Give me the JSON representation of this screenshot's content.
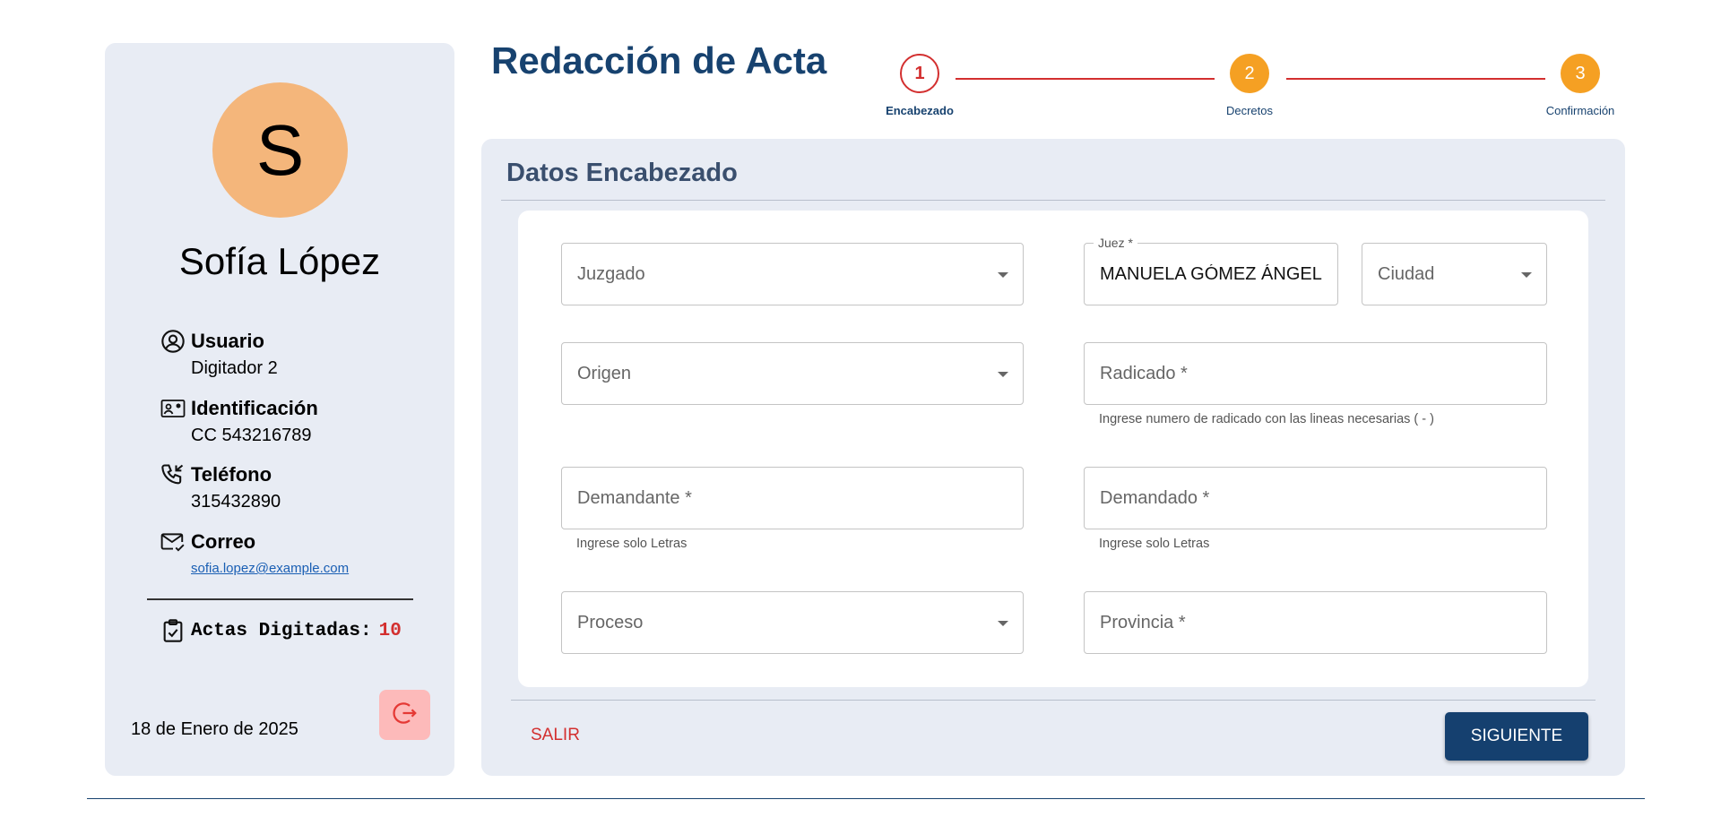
{
  "sidebar": {
    "avatar_letter": "S",
    "profile_name": "Sofía López",
    "usuario_label": "Usuario",
    "usuario_value": "Digitador 2",
    "identificacion_label": "Identificación",
    "identificacion_value": "CC 543216789",
    "telefono_label": "Teléfono",
    "telefono_value": "315432890",
    "correo_label": "Correo",
    "correo_value": "sofia.lopez@example.com",
    "actas_label": "Actas Digitadas:",
    "actas_count": "10",
    "date": "18 de Enero de 2025",
    "logout_icon": "logout-icon"
  },
  "header": {
    "title": "Redacción de Acta"
  },
  "stepper": {
    "steps": [
      {
        "number": "1",
        "label": "Encabezado",
        "state": "active"
      },
      {
        "number": "2",
        "label": "Decretos",
        "state": "pending"
      },
      {
        "number": "3",
        "label": "Confirmación",
        "state": "pending"
      }
    ]
  },
  "form": {
    "section_title": "Datos Encabezado",
    "juzgado_placeholder": "Juzgado",
    "juez_label": "Juez *",
    "juez_value": "MANUELA GÓMEZ ÁNGEL",
    "ciudad_placeholder": "Ciudad",
    "origen_placeholder": "Origen",
    "radicado_placeholder": "Radicado *",
    "radicado_helper": "Ingrese numero de radicado con las lineas necesarias ( - )",
    "demandante_placeholder": "Demandante *",
    "demandante_helper": "Ingrese solo Letras",
    "demandado_placeholder": "Demandado *",
    "demandado_helper": "Ingrese solo Letras",
    "proceso_placeholder": "Proceso",
    "provincia_placeholder": "Provincia *"
  },
  "actions": {
    "exit_label": "SALIR",
    "next_label": "SIGUIENTE"
  },
  "colors": {
    "primary": "#15406f",
    "accent_red": "#d32f2f",
    "step_pending": "#f5a023",
    "avatar_bg": "#f4b67b",
    "panel_bg": "#e8ecf4"
  }
}
